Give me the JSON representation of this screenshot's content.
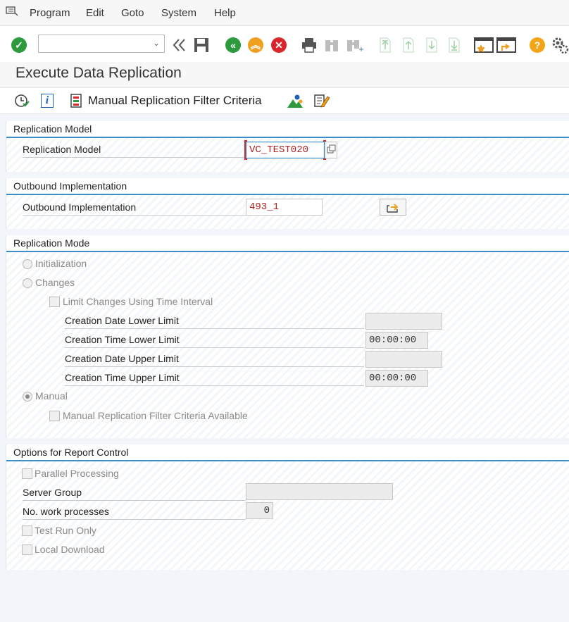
{
  "menu": {
    "items": [
      "Program",
      "Edit",
      "Goto",
      "System",
      "Help"
    ]
  },
  "toolbar": {
    "command_field_value": "",
    "icons": [
      "enter-icon",
      "back-double-icon",
      "save-icon",
      "back-icon",
      "exit-icon",
      "cancel-icon",
      "print-icon",
      "find-icon",
      "find-next-icon",
      "first-page-icon",
      "previous-page-icon",
      "next-page-icon",
      "last-page-icon",
      "create-session-icon",
      "shortcut-icon",
      "help-icon",
      "settings-icon"
    ]
  },
  "title": "Execute Data Replication",
  "app_toolbar": {
    "manual_filter_label": "Manual Replication Filter Criteria"
  },
  "replication_model": {
    "group_title": "Replication Model",
    "field_label": "Replication Model",
    "field_value": "VC_TEST020"
  },
  "outbound": {
    "group_title": "Outbound Implementation",
    "field_label": "Outbound Implementation",
    "field_value": "493_1"
  },
  "mode": {
    "group_title": "Replication Mode",
    "initialization": "Initialization",
    "changes": "Changes",
    "limit_changes": "Limit Changes Using Time Interval",
    "creation_date_lower": "Creation Date Lower Limit",
    "creation_date_lower_value": "",
    "creation_time_lower": "Creation Time Lower Limit",
    "creation_time_lower_value": "00:00:00",
    "creation_date_upper": "Creation Date Upper Limit",
    "creation_date_upper_value": "",
    "creation_time_upper": "Creation Time Upper Limit",
    "creation_time_upper_value": "00:00:00",
    "manual": "Manual",
    "manual_filter_available": "Manual Replication Filter Criteria Available"
  },
  "options": {
    "group_title": "Options for Report Control",
    "parallel_processing": "Parallel Processing",
    "server_group": "Server Group",
    "server_group_value": "",
    "work_processes": "No. work processes",
    "work_processes_value": "0",
    "test_run": "Test Run Only",
    "local_download": "Local Download"
  },
  "colors": {
    "accent_blue": "#3990c8",
    "enter_green": "#2e9a3e",
    "back_green": "#2e9a3e",
    "exit_orange": "#f0a020",
    "cancel_red": "#d9262c",
    "help_orange": "#f2a516",
    "value_red": "#b22222"
  }
}
